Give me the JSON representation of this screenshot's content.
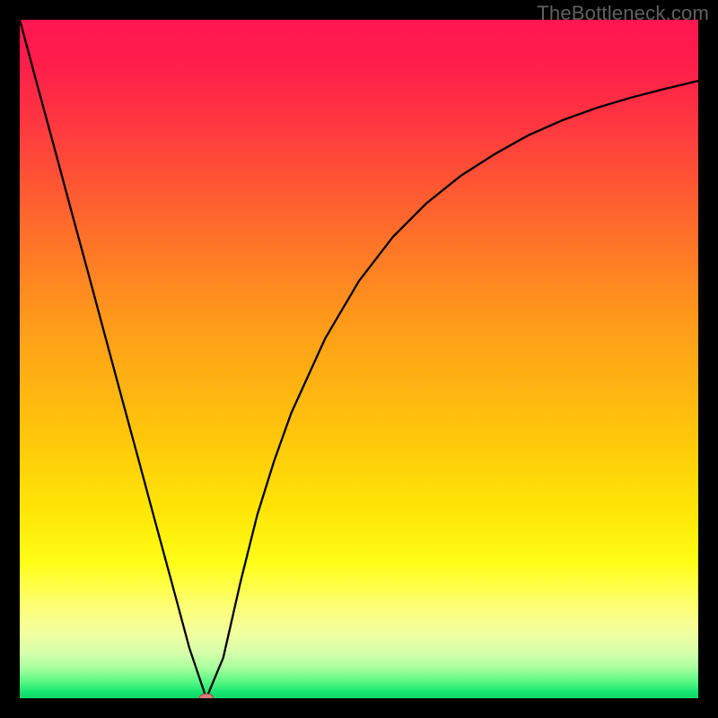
{
  "watermark": "TheBottleneck.com",
  "chart_data": {
    "type": "line",
    "title": "",
    "xlabel": "",
    "ylabel": "",
    "xlim": [
      0,
      100
    ],
    "ylim": [
      0,
      100
    ],
    "grid": false,
    "legend": false,
    "series": [
      {
        "name": "curve",
        "x": [
          0,
          2.5,
          5,
          7.5,
          10,
          12.5,
          15,
          17.5,
          20,
          22.5,
          25,
          27.5,
          30,
          32.5,
          35,
          37.5,
          40,
          45,
          50,
          55,
          60,
          65,
          70,
          75,
          80,
          85,
          90,
          95,
          100
        ],
        "y": [
          100,
          90.7,
          81.5,
          72.2,
          63.0,
          53.7,
          44.4,
          35.2,
          25.9,
          16.7,
          7.4,
          0.0,
          6.0,
          17.0,
          27.0,
          35.0,
          42.0,
          53.0,
          61.5,
          68.0,
          73.0,
          77.0,
          80.2,
          83.0,
          85.2,
          87.0,
          88.5,
          89.8,
          91.0
        ]
      }
    ],
    "min_point": {
      "x": 27.5,
      "y": 0.0
    },
    "background_gradient": {
      "type": "vertical",
      "stops": [
        {
          "pos": 0.0,
          "color": "#ff1650"
        },
        {
          "pos": 0.06,
          "color": "#ff1d4c"
        },
        {
          "pos": 0.15,
          "color": "#ff3640"
        },
        {
          "pos": 0.3,
          "color": "#ff6a2c"
        },
        {
          "pos": 0.45,
          "color": "#ff9c1a"
        },
        {
          "pos": 0.6,
          "color": "#ffc30c"
        },
        {
          "pos": 0.72,
          "color": "#ffe506"
        },
        {
          "pos": 0.8,
          "color": "#fffd16"
        },
        {
          "pos": 0.86,
          "color": "#feff6f"
        },
        {
          "pos": 0.9,
          "color": "#f4ff9c"
        },
        {
          "pos": 0.93,
          "color": "#daffab"
        },
        {
          "pos": 0.955,
          "color": "#a8ff9e"
        },
        {
          "pos": 0.975,
          "color": "#5bf885"
        },
        {
          "pos": 0.99,
          "color": "#1ae772"
        },
        {
          "pos": 1.0,
          "color": "#0bd968"
        }
      ]
    },
    "marker": {
      "color_fill": "#d77b78",
      "color_stroke": "#a64c4a",
      "rx": 8,
      "ry": 5
    },
    "line_style": {
      "stroke": "#000000",
      "width": 2.3
    }
  }
}
